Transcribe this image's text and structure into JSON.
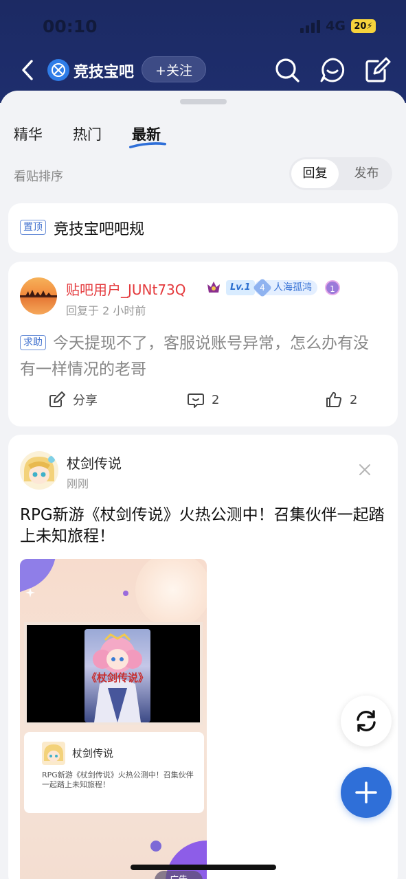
{
  "status_bar": {
    "time": "00:10",
    "network": "4G",
    "battery": "20"
  },
  "header": {
    "forum_name": "竞技宝吧",
    "follow_label": "+关注"
  },
  "tabs": [
    {
      "label": "精华",
      "active": false
    },
    {
      "label": "热门",
      "active": false
    },
    {
      "label": "最新",
      "active": true
    }
  ],
  "sort": {
    "label": "看贴排序",
    "options": [
      "回复",
      "发布"
    ],
    "selected": "回复"
  },
  "pinned": {
    "badge": "置顶",
    "title": "竞技宝吧吧规"
  },
  "post": {
    "username": "贴吧用户_JUNt73Q",
    "level": "Lv.1",
    "tag_number": "4",
    "tag_label": "人海孤鸿",
    "medal": "1",
    "reply_time": "回复于 2 小时前",
    "category_badge": "求助",
    "body": "今天提现不了，客服说账号异常，怎么办有没有一样情况的老哥",
    "share_label": "分享",
    "comment_count": "2",
    "like_count": "2"
  },
  "ad": {
    "name": "杖剑传说",
    "time": "刚刚",
    "text": "RPG新游《杖剑传说》火热公测中！召集伙伴一起踏上未知旅程！",
    "poster_title": "《杖剑传说》",
    "inner_name": "杖剑传说",
    "inner_desc": "RPG新游《杖剑传说》火热公测中！召集伙伴一起踏上未知旅程！",
    "label": "广告"
  },
  "colors": {
    "header_bg": "#1e2e6e",
    "accent": "#2f6fd8",
    "username": "#e4393c"
  }
}
